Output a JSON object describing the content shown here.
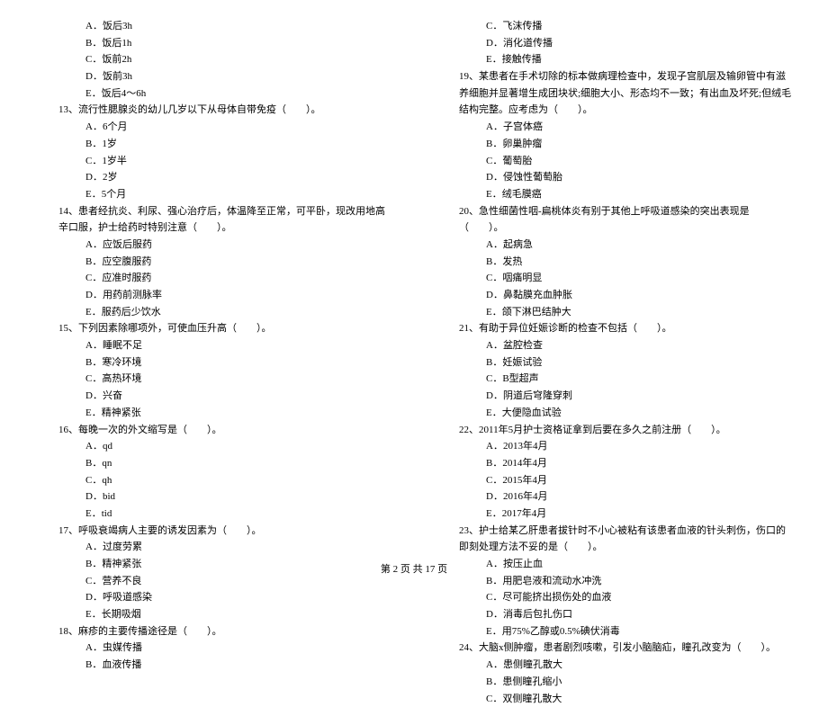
{
  "left_column": {
    "items": [
      {
        "type": "option",
        "text": "A．饭后3h"
      },
      {
        "type": "option",
        "text": "B．饭后1h"
      },
      {
        "type": "option",
        "text": "C．饭前2h"
      },
      {
        "type": "option",
        "text": "D．饭前3h"
      },
      {
        "type": "option",
        "text": "E．饭后4～6h"
      },
      {
        "type": "question",
        "text": "13、流行性腮腺炎的幼儿几岁以下从母体自带免疫（　　）。"
      },
      {
        "type": "option",
        "text": "A．6个月"
      },
      {
        "type": "option",
        "text": "B．1岁"
      },
      {
        "type": "option",
        "text": "C．1岁半"
      },
      {
        "type": "option",
        "text": "D．2岁"
      },
      {
        "type": "option",
        "text": "E．5个月"
      },
      {
        "type": "question",
        "text": "14、患者经抗炎、利尿、强心治疗后，体温降至正常，可平卧，现改用地高辛口服，护士给药时特别注意（　　）。"
      },
      {
        "type": "option",
        "text": "A．应饭后服药"
      },
      {
        "type": "option",
        "text": "B．应空腹服药"
      },
      {
        "type": "option",
        "text": "C．应准时服药"
      },
      {
        "type": "option",
        "text": "D．用药前测脉率"
      },
      {
        "type": "option",
        "text": "E．服药后少饮水"
      },
      {
        "type": "question",
        "text": "15、下列因素除哪项外，可使血压升高（　　）。"
      },
      {
        "type": "option",
        "text": "A．睡眠不足"
      },
      {
        "type": "option",
        "text": "B．寒冷环境"
      },
      {
        "type": "option",
        "text": "C．高热环境"
      },
      {
        "type": "option",
        "text": "D．兴奋"
      },
      {
        "type": "option",
        "text": "E．精神紧张"
      },
      {
        "type": "question",
        "text": "16、每晚一次的外文缩写是（　　）。"
      },
      {
        "type": "option",
        "text": "A．qd"
      },
      {
        "type": "option",
        "text": "B．qn"
      },
      {
        "type": "option",
        "text": "C．qh"
      },
      {
        "type": "option",
        "text": "D．bid"
      },
      {
        "type": "option",
        "text": "E．tid"
      },
      {
        "type": "question",
        "text": "17、呼吸衰竭病人主要的诱发因素为（　　）。"
      },
      {
        "type": "option",
        "text": "A．过度劳累"
      },
      {
        "type": "option",
        "text": "B．精神紧张"
      },
      {
        "type": "option",
        "text": "C．营养不良"
      },
      {
        "type": "option",
        "text": "D．呼吸道感染"
      },
      {
        "type": "option",
        "text": "E．长期吸烟"
      },
      {
        "type": "question",
        "text": "18、麻疹的主要传播途径是（　　）。"
      },
      {
        "type": "option",
        "text": "A．虫媒传播"
      },
      {
        "type": "option",
        "text": "B．血液传播"
      }
    ]
  },
  "right_column": {
    "items": [
      {
        "type": "option",
        "text": "C．飞沫传播"
      },
      {
        "type": "option",
        "text": "D．消化道传播"
      },
      {
        "type": "option",
        "text": "E．接触传播"
      },
      {
        "type": "question",
        "text": "19、某患者在手术切除的标本做病理检查中，发现子宫肌层及输卵管中有滋养细胞并显著增生成团块状;细胞大小、形态均不一致；有出血及坏死;但绒毛结构完整。应考虑为（　　）。"
      },
      {
        "type": "option",
        "text": "A．子宫体癌"
      },
      {
        "type": "option",
        "text": "B．卵巢肿瘤"
      },
      {
        "type": "option",
        "text": "C．葡萄胎"
      },
      {
        "type": "option",
        "text": "D．侵蚀性葡萄胎"
      },
      {
        "type": "option",
        "text": "E．绒毛膜癌"
      },
      {
        "type": "question",
        "text": "20、急性细菌性咽-扁桃体炎有别于其他上呼吸道感染的突出表现是（　　）。"
      },
      {
        "type": "option",
        "text": "A．起病急"
      },
      {
        "type": "option",
        "text": "B．发热"
      },
      {
        "type": "option",
        "text": "C．咽痛明显"
      },
      {
        "type": "option",
        "text": "D．鼻黏膜充血肿胀"
      },
      {
        "type": "option",
        "text": "E．颌下淋巴结肿大"
      },
      {
        "type": "question",
        "text": "21、有助于异位妊娠诊断的检查不包括（　　）。"
      },
      {
        "type": "option",
        "text": "A．盆腔检查"
      },
      {
        "type": "option",
        "text": "B．妊娠试验"
      },
      {
        "type": "option",
        "text": "C．B型超声"
      },
      {
        "type": "option",
        "text": "D．阴道后穹隆穿刺"
      },
      {
        "type": "option",
        "text": "E．大便隐血试验"
      },
      {
        "type": "question",
        "text": "22、2011年5月护士资格证拿到后要在多久之前注册（　　）。"
      },
      {
        "type": "option",
        "text": "A．2013年4月"
      },
      {
        "type": "option",
        "text": "B．2014年4月"
      },
      {
        "type": "option",
        "text": "C．2015年4月"
      },
      {
        "type": "option",
        "text": "D．2016年4月"
      },
      {
        "type": "option",
        "text": "E．2017年4月"
      },
      {
        "type": "question",
        "text": "23、护士给某乙肝患者拔针时不小心被粘有该患者血液的针头刺伤，伤口的即刻处理方法不妥的是（　　）。"
      },
      {
        "type": "option",
        "text": "A．按压止血"
      },
      {
        "type": "option",
        "text": "B．用肥皂液和流动水冲洗"
      },
      {
        "type": "option",
        "text": "C．尽可能挤出损伤处的血液"
      },
      {
        "type": "option",
        "text": "D．消毒后包扎伤口"
      },
      {
        "type": "option",
        "text": "E．用75%乙醇或0.5%碘伏消毒"
      },
      {
        "type": "question",
        "text": "24、大脑x侧肿瘤，患者剧烈咳嗽，引发小脑脑疝，瞳孔改变为（　　）。"
      },
      {
        "type": "option",
        "text": "A．患侧瞳孔散大"
      },
      {
        "type": "option",
        "text": "B．患侧瞳孔缩小"
      },
      {
        "type": "option",
        "text": "C．双侧瞳孔散大"
      }
    ]
  },
  "footer": "第 2 页 共 17 页"
}
